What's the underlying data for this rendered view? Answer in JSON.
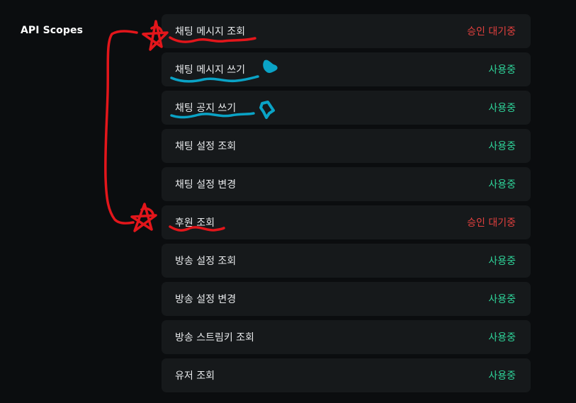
{
  "section": {
    "title": "API Scopes"
  },
  "colors": {
    "background": "#0b0d0f",
    "row_background": "#16191b",
    "pending": "#e2403e",
    "active": "#2fd49a",
    "annotation_red": "#e3161b",
    "annotation_blue": "#0aa3c6"
  },
  "scopes": [
    {
      "name": "채팅 메시지 조회",
      "status": "승인 대기중",
      "state": "pending"
    },
    {
      "name": "채팅 메시지 쓰기",
      "status": "사용중",
      "state": "active"
    },
    {
      "name": "채팅 공지 쓰기",
      "status": "사용중",
      "state": "active"
    },
    {
      "name": "채팅 설정 조회",
      "status": "사용중",
      "state": "active"
    },
    {
      "name": "채팅 설정 변경",
      "status": "사용중",
      "state": "active"
    },
    {
      "name": "후원 조회",
      "status": "승인 대기중",
      "state": "pending"
    },
    {
      "name": "방송 설정 조회",
      "status": "사용중",
      "state": "active"
    },
    {
      "name": "방송 설정 변경",
      "status": "사용중",
      "state": "active"
    },
    {
      "name": "방송 스트림키 조회",
      "status": "사용중",
      "state": "active"
    },
    {
      "name": "유저 조회",
      "status": "사용중",
      "state": "active"
    }
  ]
}
